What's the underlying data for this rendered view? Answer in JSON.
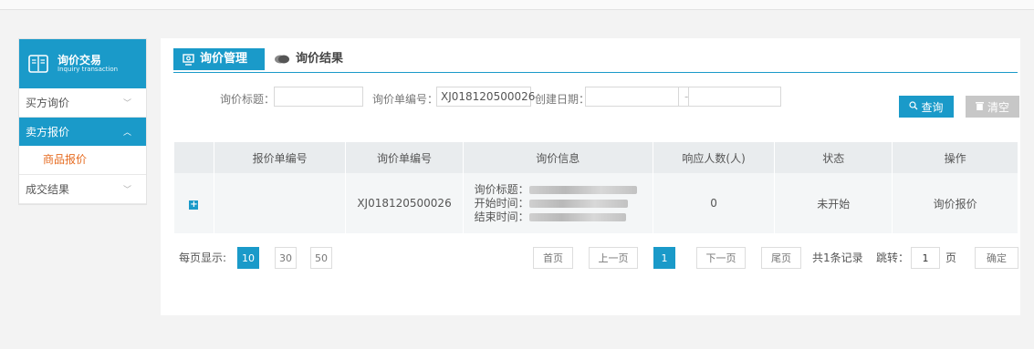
{
  "sidebar": {
    "title_cn": "询价交易",
    "title_en": "Inquiry transaction",
    "items": [
      {
        "label": "买方询价"
      },
      {
        "label": "卖方报价"
      },
      {
        "label": "成交结果"
      }
    ],
    "subitem": "商品报价"
  },
  "tabs": [
    {
      "label": "询价管理"
    },
    {
      "label": "询价结果"
    }
  ],
  "search": {
    "title_label": "询价标题：",
    "title_value": "",
    "code_label": "询价单编号：",
    "code_value": "XJ018120500026",
    "date_label": "创建日期：",
    "date_sep": "-",
    "query_label": "查询",
    "clear_label": "清空"
  },
  "table": {
    "headers": [
      "报价单编号",
      "询价单编号",
      "询价信息",
      "响应人数(人)",
      "状态",
      "操作"
    ],
    "rows": [
      {
        "expand": "+",
        "quote_no": "",
        "inquiry_no": "XJ018120500026",
        "info_title": "询价标题：",
        "info_start": "开始时间：",
        "info_end": "结束时间：",
        "responders": "0",
        "status": "未开始",
        "action": "询价报价"
      }
    ]
  },
  "pagination": {
    "per_page_label": "每页显示:",
    "sizes": [
      "10",
      "30",
      "50"
    ],
    "first": "首页",
    "prev": "上一页",
    "current": "1",
    "next": "下一页",
    "last": "尾页",
    "total": "共1条记录",
    "jump_label": "跳转：",
    "jump_value": "1",
    "page_unit": "页",
    "confirm": "确定"
  },
  "colors": {
    "accent": "#1a9ac9",
    "highlight": "#e66b20"
  }
}
